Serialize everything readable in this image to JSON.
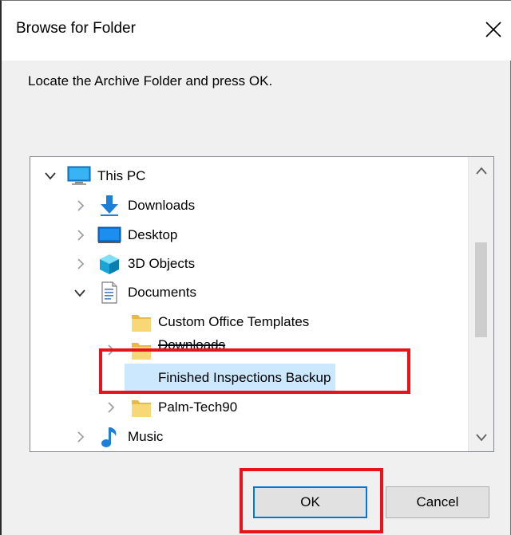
{
  "window": {
    "title": "Browse for Folder"
  },
  "prompt": "Locate the Archive Folder and press OK.",
  "tree": {
    "items": [
      {
        "label": "This PC",
        "icon": "computer-icon",
        "expanded": true
      },
      {
        "label": "Downloads",
        "icon": "download-arrow-icon",
        "expanded": false
      },
      {
        "label": "Desktop",
        "icon": "desktop-icon",
        "expanded": false
      },
      {
        "label": "3D Objects",
        "icon": "3d-objects-icon",
        "expanded": false
      },
      {
        "label": "Documents",
        "icon": "documents-icon",
        "expanded": true
      },
      {
        "label": "Custom Office Templates",
        "icon": "folder-icon"
      },
      {
        "label": "Downloads",
        "icon": "folder-icon",
        "expanded": false
      },
      {
        "label": "Finished Inspections Backup",
        "icon": "folder-icon",
        "selected": true
      },
      {
        "label": "Palm-Tech90",
        "icon": "folder-icon",
        "expanded": false
      },
      {
        "label": "Music",
        "icon": "music-icon",
        "expanded": false
      }
    ]
  },
  "buttons": {
    "ok": "OK",
    "cancel": "Cancel"
  },
  "colors": {
    "selection": "#cce8ff",
    "highlight_box": "#e8121a",
    "default_button_border": "#0078d7",
    "folder": "#f8d775"
  }
}
